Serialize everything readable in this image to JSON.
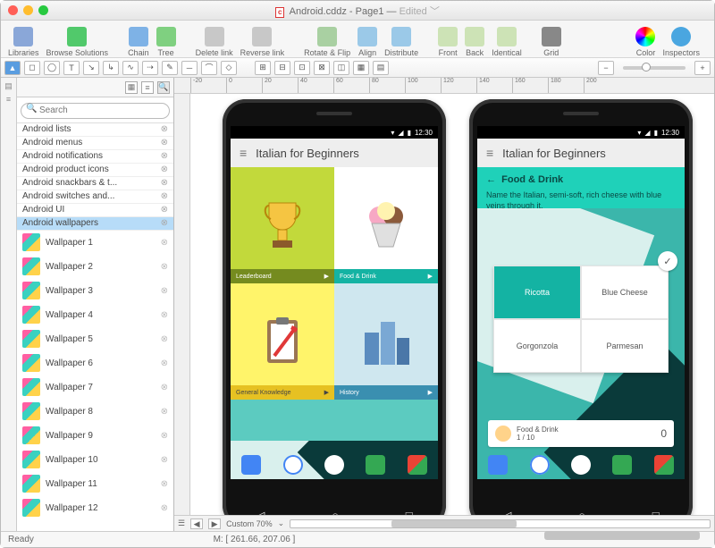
{
  "title": {
    "filename": "Android.cddz",
    "page": "Page1",
    "edited": "Edited"
  },
  "toolbar": [
    {
      "label": "Libraries",
      "color": "#8aa7d8"
    },
    {
      "label": "Browse Solutions",
      "color": "#51c96b"
    },
    {
      "label": "Chain",
      "color": "#7eb2e6"
    },
    {
      "label": "Tree",
      "color": "#7fd080"
    },
    {
      "label": "Delete link",
      "color": "#c8c8c8"
    },
    {
      "label": "Reverse link",
      "color": "#c8c8c8"
    },
    {
      "label": "Rotate & Flip",
      "color": "#a9d0a2"
    },
    {
      "label": "Align",
      "color": "#9bc9e8"
    },
    {
      "label": "Distribute",
      "color": "#9bc9e8"
    },
    {
      "label": "Front",
      "color": "#cde3b6"
    },
    {
      "label": "Back",
      "color": "#cde3b6"
    },
    {
      "label": "Identical",
      "color": "#cde3b6"
    },
    {
      "label": "Grid",
      "color": "#888"
    },
    {
      "label": "Color",
      "color": "conic"
    },
    {
      "label": "Inspectors",
      "color": "#4aa6e0"
    }
  ],
  "sidebar": {
    "search_placeholder": "Search",
    "categories": [
      {
        "label": "Android lists"
      },
      {
        "label": "Android menus"
      },
      {
        "label": "Android notifications"
      },
      {
        "label": "Android product icons"
      },
      {
        "label": "Android snackbars & t..."
      },
      {
        "label": "Android switches and..."
      },
      {
        "label": "Android UI"
      },
      {
        "label": "Android wallpapers",
        "selected": true
      }
    ],
    "items": [
      {
        "label": "Wallpaper 1"
      },
      {
        "label": "Wallpaper 2"
      },
      {
        "label": "Wallpaper 3"
      },
      {
        "label": "Wallpaper 4"
      },
      {
        "label": "Wallpaper 5"
      },
      {
        "label": "Wallpaper 6"
      },
      {
        "label": "Wallpaper 7"
      },
      {
        "label": "Wallpaper 8"
      },
      {
        "label": "Wallpaper 9"
      },
      {
        "label": "Wallpaper 10"
      },
      {
        "label": "Wallpaper 11"
      },
      {
        "label": "Wallpaper 12"
      }
    ]
  },
  "ruler": [
    "-20",
    "0",
    "20",
    "40",
    "60",
    "80",
    "100",
    "120",
    "140",
    "160",
    "180",
    "200"
  ],
  "phone": {
    "time": "12:30",
    "app_title": "Italian for Beginners",
    "cards": [
      {
        "label": "Leaderboard"
      },
      {
        "label": "Food & Drink"
      },
      {
        "label": "General Knowledge"
      },
      {
        "label": "History"
      }
    ]
  },
  "quiz": {
    "crumb": "Food & Drink",
    "question": "Name the Italian, semi-soft, rich cheese with blue veins through it.",
    "answers": [
      "Ricotta",
      "Blue Cheese",
      "Gorgonzola",
      "Parmesan"
    ],
    "score_cat": "Food & Drink",
    "score_prog": "1 / 10",
    "score_val": "0"
  },
  "zoom": "Custom 70%",
  "status": {
    "left": "Ready",
    "mid": "M: [ 261.66, 207.06 ]"
  }
}
